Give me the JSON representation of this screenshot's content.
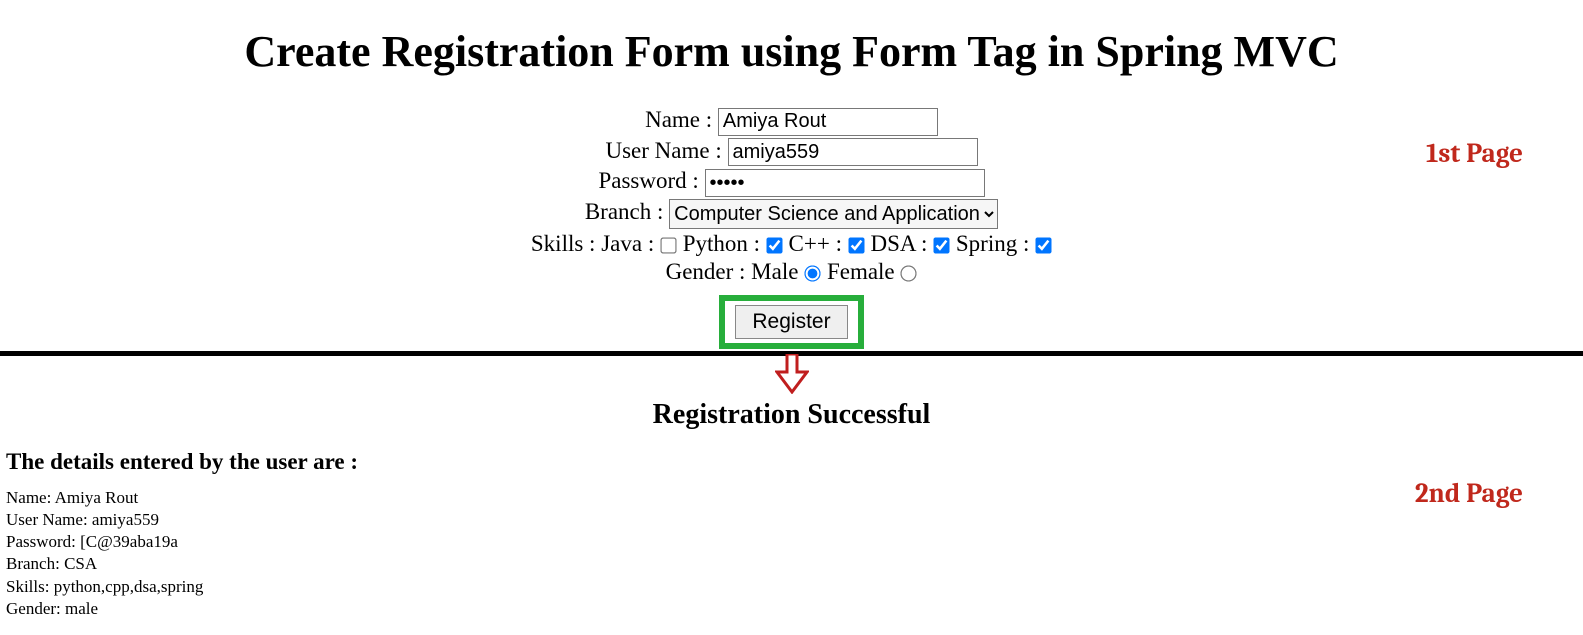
{
  "page1": {
    "title": "Create Registration Form using Form Tag in Spring MVC",
    "name_label": "Name :",
    "name_value": "Amiya Rout",
    "username_label": "User Name :",
    "username_value": "amiya559",
    "password_label": "Password :",
    "password_value": "•••••",
    "branch_label": "Branch :",
    "branch_selected": "Computer Science and Application",
    "skills_label": "Skills :",
    "skills": [
      {
        "label": "Java :",
        "checked": false
      },
      {
        "label": "Python :",
        "checked": true
      },
      {
        "label": "C++ :",
        "checked": true
      },
      {
        "label": "DSA :",
        "checked": true
      },
      {
        "label": "Spring :",
        "checked": true
      }
    ],
    "gender_label": "Gender :",
    "gender_options": [
      {
        "label": "Male",
        "selected": true
      },
      {
        "label": "Female",
        "selected": false
      }
    ],
    "register_label": "Register"
  },
  "page2": {
    "success_title": "Registration Successful",
    "heading": "The details entered by the user are :",
    "lines": [
      "Name: Amiya Rout",
      "User Name: amiya559",
      "Password: [C@39aba19a",
      "Branch: CSA",
      "Skills: python,cpp,dsa,spring",
      "Gender: male"
    ]
  },
  "annotations": {
    "first": "1st Page",
    "second": "2nd Page"
  },
  "colors": {
    "highlight_border": "#27ae3b",
    "annotation": "#c0281c"
  }
}
